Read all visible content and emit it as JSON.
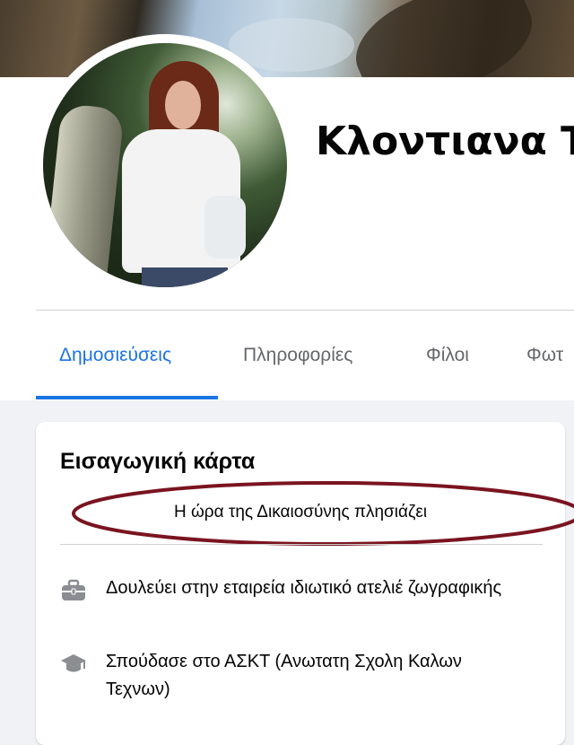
{
  "profile": {
    "name": "Κλοντιανα Τ"
  },
  "tabs": [
    {
      "label": "Δημοσιεύσεις",
      "active": true
    },
    {
      "label": "Πληροφορίες",
      "active": false
    },
    {
      "label": "Φίλοι",
      "active": false
    },
    {
      "label": "Φωτ",
      "active": false
    }
  ],
  "intro": {
    "title": "Εισαγωγική κάρτα",
    "bio": "Η ώρα της Δικαιοσύνης πλησιάζει",
    "items": [
      {
        "icon": "briefcase-icon",
        "text": "Δουλεύει στην εταιρεία ιδιωτικό ατελιέ ζωγραφικής"
      },
      {
        "icon": "graduation-cap-icon",
        "text": "Σπούδασε στο ΑΣΚΤ (Ανωτατη Σχολη Καλων Τεχνων)"
      }
    ]
  },
  "colors": {
    "accent": "#1b74e4",
    "annotation_ellipse": "#7a1420",
    "page_background": "#f0f2f5"
  }
}
